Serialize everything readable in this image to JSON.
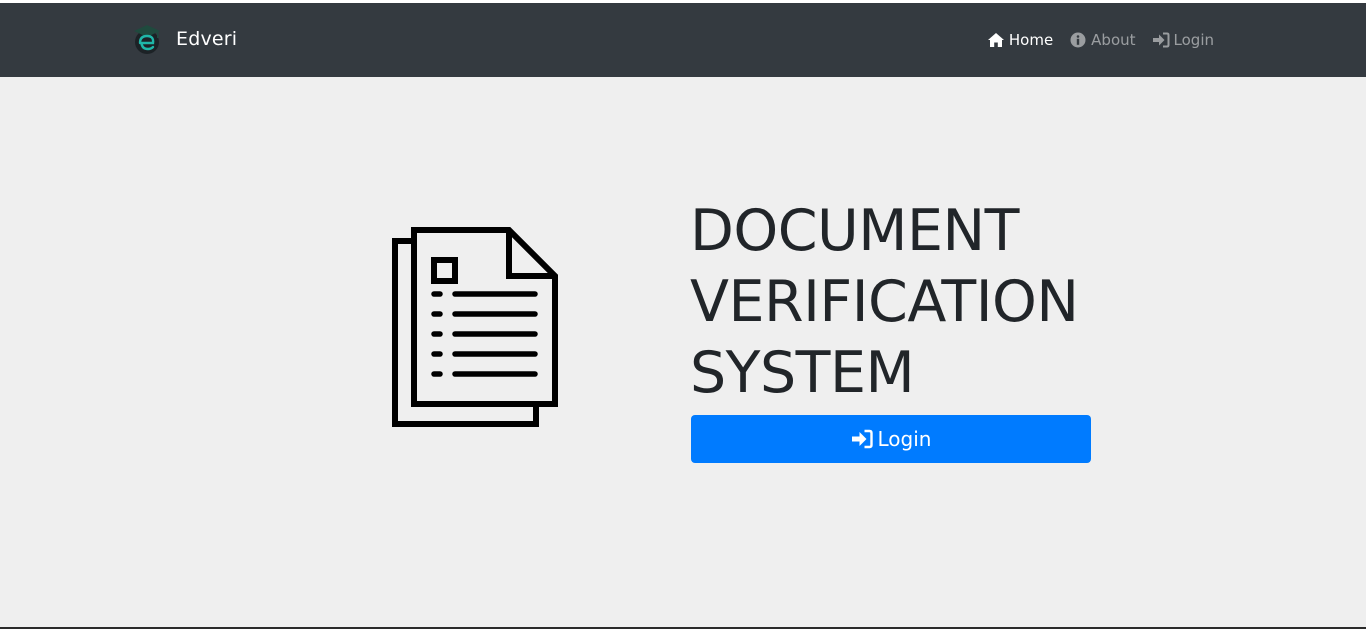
{
  "navbar": {
    "brand_name": "Edveri",
    "logo_icon": "graduation-cap-e-logo",
    "links": [
      {
        "label": "Home",
        "icon": "home-icon",
        "active": true
      },
      {
        "label": "About",
        "icon": "info-circle-icon",
        "active": false
      },
      {
        "label": "Login",
        "icon": "sign-in-icon",
        "active": false
      }
    ]
  },
  "hero": {
    "illustration_icon": "document-file-icon",
    "title_lines": [
      "DOCUMENT",
      "VERIFICATION",
      "SYSTEM"
    ],
    "login_button_label": "Login",
    "login_button_icon": "sign-in-icon"
  },
  "colors": {
    "navbar_bg": "#343a40",
    "page_bg": "#efefef",
    "primary": "#007bff",
    "heading": "#212529"
  }
}
